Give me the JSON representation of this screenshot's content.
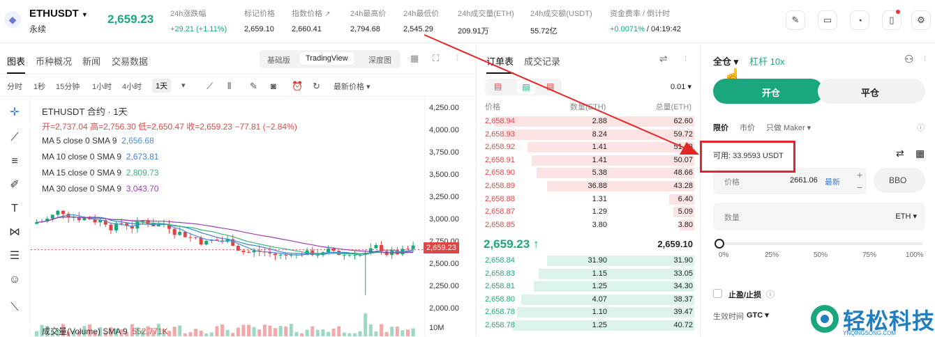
{
  "header": {
    "symbol": "ETHUSDT",
    "symbol_caret": "▾",
    "contract_type": "永续",
    "last_price": "2,659.23",
    "stats": [
      {
        "label": "24h涨跌幅",
        "value": "+29.21 (+1.11%)",
        "positive": true
      },
      {
        "label": "标记价格",
        "value": "2,659.10"
      },
      {
        "label": "指数价格",
        "value": "2,660.41"
      },
      {
        "label": "24h最高价",
        "value": "2,794.68"
      },
      {
        "label": "24h最低价",
        "value": "2,545.29"
      },
      {
        "label": "24h成交量(ETH)",
        "value": "209.91万"
      },
      {
        "label": "24h成交额(USDT)",
        "value": "55.72亿"
      },
      {
        "label": "资金费率 / 倒计时",
        "value_pos": "+0.0071%",
        "value_rest": " / 04:19:42"
      }
    ]
  },
  "chart_panel": {
    "tabs": [
      "图表",
      "币种概况",
      "新闻",
      "交易数据"
    ],
    "views": [
      "基础版",
      "TradingView",
      "深度图"
    ],
    "timeframes": [
      "分时",
      "1秒",
      "15分钟",
      "1小时",
      "4小时",
      "1天"
    ],
    "price_type": "最新价格 ▾",
    "caret": "▾",
    "title": "ETHUSDT 合约 · 1天",
    "ohlc": {
      "open": "开=2,737.04",
      "high": "高=2,756.30",
      "low": "低=2,650.47",
      "close": "收=2,659.23",
      "change": "−77.81 (−2.84%)"
    },
    "ma_lines": [
      {
        "label": "MA 5 close 0 SMA 9",
        "value": "2,656.68",
        "color": "#4a90d9"
      },
      {
        "label": "MA 10 close 0 SMA 9",
        "value": "2,673.81",
        "color": "#3f7fd0"
      },
      {
        "label": "MA 15 close 0 SMA 9",
        "value": "2,809.73",
        "color": "#36b37e"
      },
      {
        "label": "MA 30 close 0 SMA 9",
        "value": "3,043.70",
        "color": "#9c3fae"
      }
    ],
    "volume_label": "成交量(Volume) SMA 9",
    "volume_value": "552.771K",
    "price_axis": [
      "4,250.00",
      "4,000.00",
      "3,750.00",
      "3,500.00",
      "3,250.00",
      "3,000.00",
      "2,750.00",
      "2,500.00",
      "2,250.00",
      "2,000.00"
    ],
    "current_price_label": "2,659.23",
    "volume_axis_label": "10M"
  },
  "orderbook": {
    "tabs": [
      "订单表",
      "成交记录"
    ],
    "precision": "0.01 ▾",
    "headers": {
      "price": "价格",
      "qty": "数量(ETH)",
      "total": "总量(ETH)"
    },
    "asks": [
      {
        "price": "2,658.94",
        "qty": "2.88",
        "total": "62.60",
        "depth": 0.95
      },
      {
        "price": "2,658.93",
        "qty": "8.24",
        "total": "59.72",
        "depth": 0.91
      },
      {
        "price": "2,658.92",
        "qty": "1.41",
        "total": "51.48",
        "depth": 0.79
      },
      {
        "price": "2,658.91",
        "qty": "1.41",
        "total": "50.07",
        "depth": 0.77
      },
      {
        "price": "2,658.90",
        "qty": "5.38",
        "total": "48.66",
        "depth": 0.75
      },
      {
        "price": "2,658.89",
        "qty": "36.88",
        "total": "43.28",
        "depth": 0.7
      },
      {
        "price": "2,658.88",
        "qty": "1.31",
        "total": "6.40",
        "depth": 0.12
      },
      {
        "price": "2,658.87",
        "qty": "1.29",
        "total": "5.09",
        "depth": 0.1
      },
      {
        "price": "2,658.85",
        "qty": "3.80",
        "total": "3.80",
        "depth": 0.07
      }
    ],
    "mid_price": "2,659.23 ↑",
    "mid_mark": "2,659.10",
    "bids": [
      {
        "price": "2,658.84",
        "qty": "31.90",
        "total": "31.90",
        "depth": 0.7
      },
      {
        "price": "2,658.83",
        "qty": "1.15",
        "total": "33.05",
        "depth": 0.74
      },
      {
        "price": "2,658.81",
        "qty": "1.25",
        "total": "34.30",
        "depth": 0.76
      },
      {
        "price": "2,658.80",
        "qty": "4.07",
        "total": "38.37",
        "depth": 0.82
      },
      {
        "price": "2,658.78",
        "qty": "1.10",
        "total": "39.47",
        "depth": 0.84
      },
      {
        "price": "2,658.78",
        "qty": "1.25",
        "total": "40.72",
        "depth": 0.86
      }
    ]
  },
  "trade_panel": {
    "margin_mode": "全仓 ▾",
    "leverage": "杠杆 10x",
    "open_label": "开仓",
    "close_label": "平仓",
    "order_types": [
      "限价",
      "市价",
      "只做 Maker ▾"
    ],
    "available": "可用: 33.9593 USDT",
    "price_label": "价格",
    "price_value": "2661.06",
    "price_latest": "最新",
    "bbo_label": "BBO",
    "qty_label": "数量",
    "qty_unit": "ETH ▾",
    "slider_ticks": [
      "0%",
      "25%",
      "50%",
      "75%",
      "100%"
    ],
    "tpsl_label": "止盈/止损",
    "tif_label": "生效时间",
    "tif_value": "GTC ▾",
    "plus": "+",
    "minus": "−"
  },
  "watermark": {
    "title": "轻松科技",
    "subtitle": "YNQINGSONG.COM"
  },
  "colors": {
    "up": "#1aa77e",
    "down": "#e24444",
    "accent": "#1aa77e",
    "highlight": "#e52626"
  }
}
